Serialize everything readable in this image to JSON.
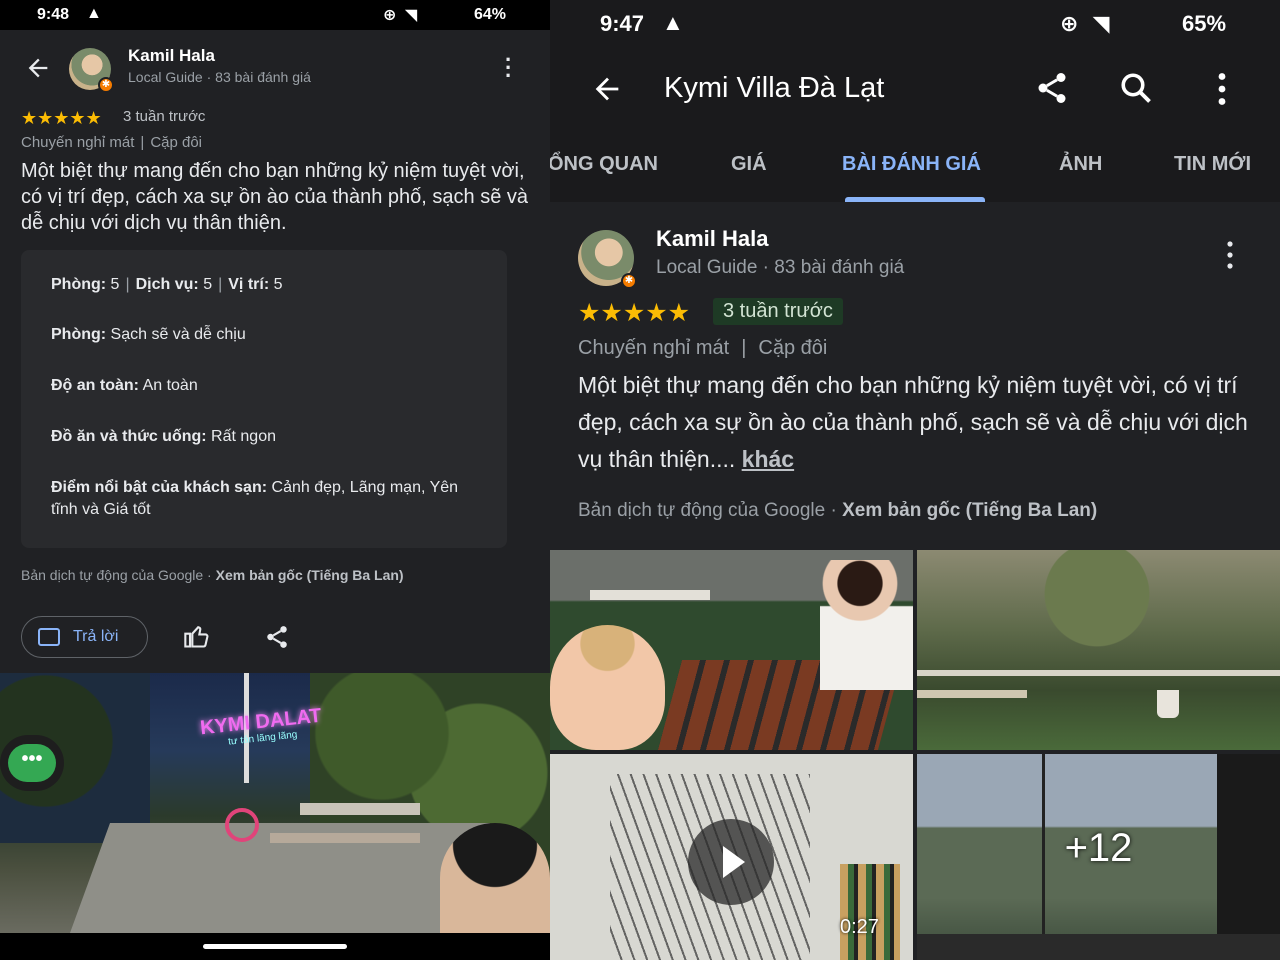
{
  "left": {
    "status": {
      "time": "9:48",
      "battery": "64%"
    },
    "reviewer": {
      "name": "Kamil Hala",
      "subtitle": "Local Guide · 83 bài đánh giá"
    },
    "review": {
      "stars": "★★★★★",
      "when": "3 tuần trước",
      "trip": "Chuyến nghỉ mát",
      "trip_type": "Cặp đôi",
      "text": "Một biệt thự mang đến cho bạn những kỷ niệm tuyệt vời, có vị trí đẹp, cách xa sự ồn ào của thành phố, sạch sẽ và dễ chịu với dịch vụ thân thiện."
    },
    "ratings": {
      "room_label": "Phòng:",
      "room_value": "5",
      "service_label": "Dịch vụ:",
      "service_value": "5",
      "location_label": "Vị trí:",
      "location_value": "5",
      "rooms_label": "Phòng:",
      "rooms_value": "Sạch sẽ và dễ chịu",
      "safety_label": "Độ an toàn:",
      "safety_value": "An toàn",
      "food_label": "Đồ ăn và thức uống:",
      "food_value": "Rất ngon",
      "highlights_label": "Điểm nổi bật của khách sạn:",
      "highlights_value": "Cảnh đẹp, Lãng mạn, Yên tĩnh và Giá tốt"
    },
    "translation": {
      "prefix": "Bản dịch tự động của Google · ",
      "link": "Xem bản gốc (Tiếng Ba Lan)"
    },
    "actions": {
      "reply": "Trả lời"
    },
    "photo": {
      "sign": "KYMI DALAT",
      "sign_sub": "tư tán lãng lãng"
    },
    "fab": "•••"
  },
  "right": {
    "status": {
      "time": "9:47",
      "battery": "65%"
    },
    "title": "Kymi Villa Đà Lạt",
    "tabs": [
      "ỔNG QUAN",
      "GIÁ",
      "BÀI ĐÁNH GIÁ",
      "ẢNH",
      "TIN MỚI"
    ],
    "reviewer": {
      "name": "Kamil Hala",
      "subtitle": "Local Guide · 83 bài đánh giá"
    },
    "review": {
      "stars": "★★★★★",
      "when": "3 tuần trước",
      "trip": "Chuyến nghỉ mát",
      "trip_type": "Cặp đôi",
      "text": "Một biệt thự mang đến cho bạn những kỷ niệm tuyệt vời, có vị trí đẹp, cách xa sự ồn ào của thành phố, sạch sẽ và dễ chịu với dịch vụ thân thiện....",
      "more": "khác"
    },
    "translation": {
      "prefix": "Bản dịch tự động của Google · ",
      "link": "Xem bản gốc (Tiếng Ba Lan)"
    },
    "media": {
      "video_duration": "0:27",
      "more_count": "+12"
    }
  },
  "colors": {
    "accent": "#8ab4f8",
    "star": "#fbbc04",
    "background": "#202124",
    "badge": "#f57c00"
  },
  "icons": [
    "back-arrow-icon",
    "more-vert-icon",
    "share-icon",
    "search-icon",
    "reply-icon",
    "thumbs-up-icon",
    "play-icon",
    "warning-icon",
    "wifi-icon",
    "signal-icon",
    "battery-icon"
  ]
}
